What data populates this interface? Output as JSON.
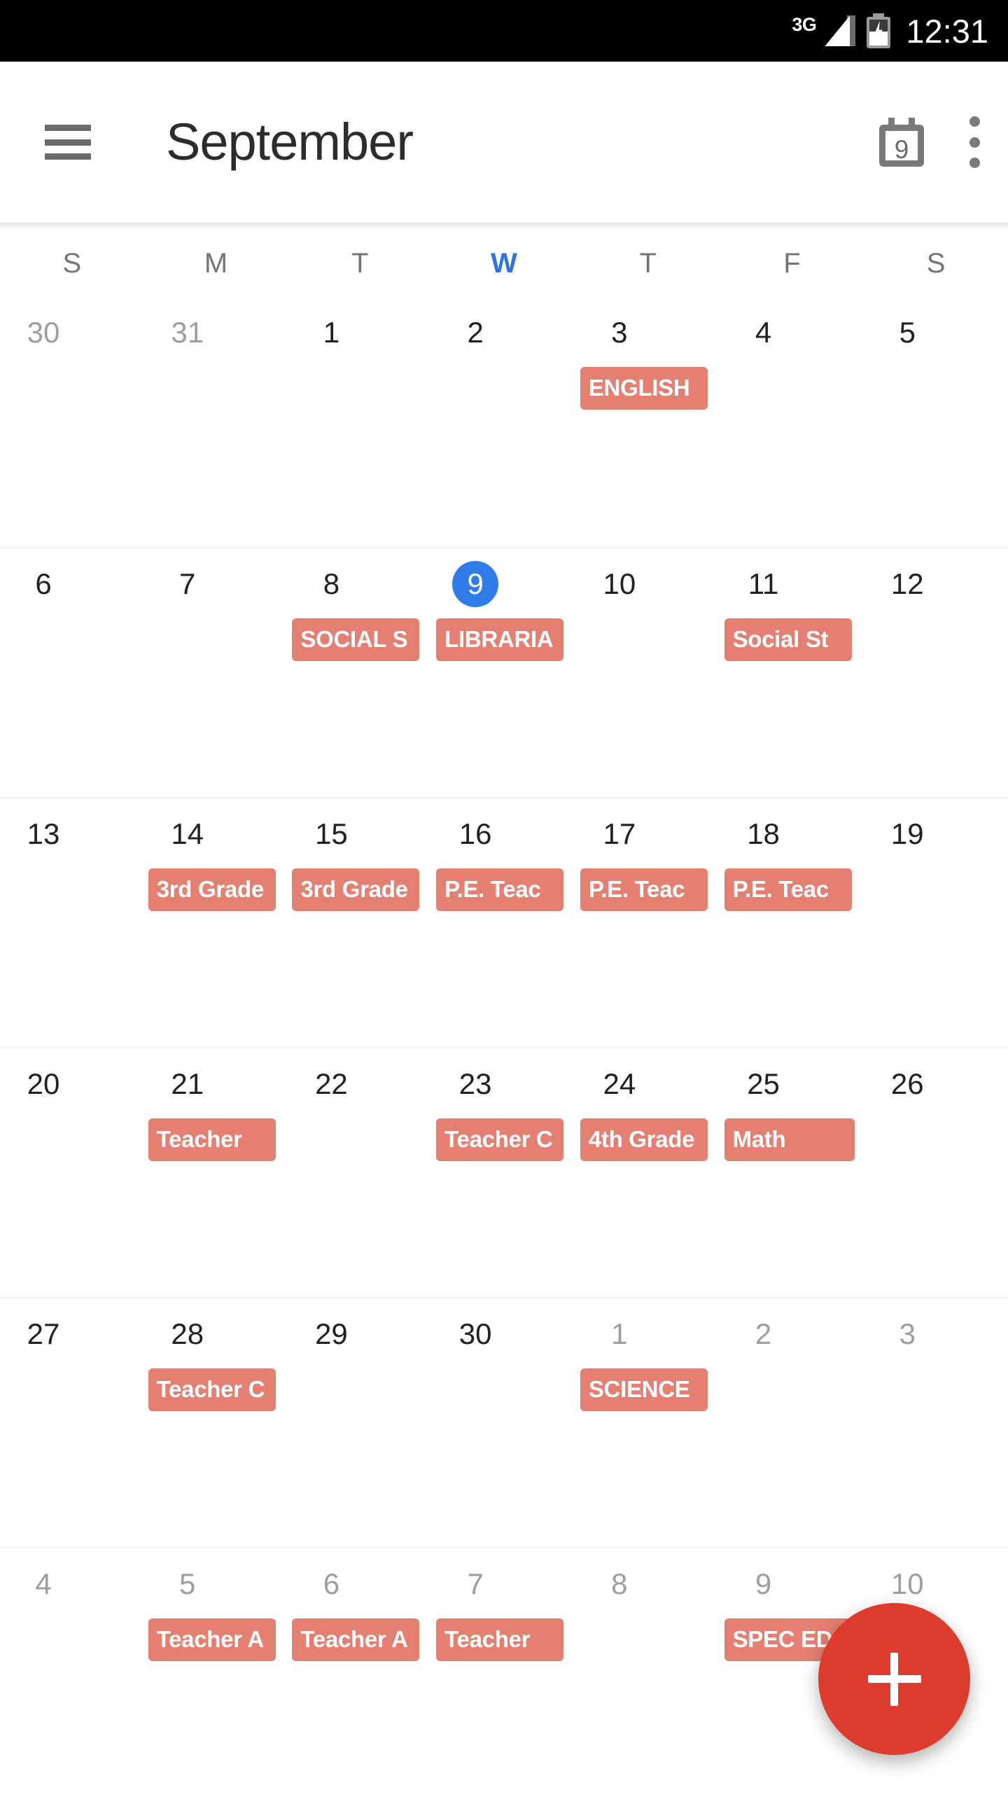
{
  "status_bar": {
    "network_type": "3G",
    "signal_icon": "signal-bars-icon",
    "battery_icon": "battery-charging-icon",
    "time": "12:31"
  },
  "app_bar": {
    "menu_icon": "hamburger-menu-icon",
    "title": "September",
    "today_icon": "calendar-today-icon",
    "today_icon_day": "9",
    "overflow_icon": "overflow-menu-icon"
  },
  "calendar": {
    "weekday_headers": [
      {
        "label": "S",
        "is_today": false
      },
      {
        "label": "M",
        "is_today": false
      },
      {
        "label": "T",
        "is_today": false
      },
      {
        "label": "W",
        "is_today": true
      },
      {
        "label": "T",
        "is_today": false
      },
      {
        "label": "F",
        "is_today": false
      },
      {
        "label": "S",
        "is_today": false
      }
    ],
    "accent_today_color": "#2f7ce8",
    "event_chip_color": "#e47f72",
    "fab_color": "#dd3b2d",
    "weeks": [
      [
        {
          "day": "30",
          "muted": true,
          "today": false,
          "events": []
        },
        {
          "day": "31",
          "muted": true,
          "today": false,
          "events": []
        },
        {
          "day": "1",
          "muted": false,
          "today": false,
          "events": []
        },
        {
          "day": "2",
          "muted": false,
          "today": false,
          "events": []
        },
        {
          "day": "3",
          "muted": false,
          "today": false,
          "events": [
            "ENGLISH"
          ]
        },
        {
          "day": "4",
          "muted": false,
          "today": false,
          "events": []
        },
        {
          "day": "5",
          "muted": false,
          "today": false,
          "events": []
        }
      ],
      [
        {
          "day": "6",
          "muted": false,
          "today": false,
          "events": []
        },
        {
          "day": "7",
          "muted": false,
          "today": false,
          "events": []
        },
        {
          "day": "8",
          "muted": false,
          "today": false,
          "events": [
            "SOCIAL S"
          ]
        },
        {
          "day": "9",
          "muted": false,
          "today": true,
          "events": [
            "LIBRARIA"
          ]
        },
        {
          "day": "10",
          "muted": false,
          "today": false,
          "events": []
        },
        {
          "day": "11",
          "muted": false,
          "today": false,
          "events": [
            "Social St"
          ]
        },
        {
          "day": "12",
          "muted": false,
          "today": false,
          "events": []
        }
      ],
      [
        {
          "day": "13",
          "muted": false,
          "today": false,
          "events": []
        },
        {
          "day": "14",
          "muted": false,
          "today": false,
          "events": [
            "3rd Grade"
          ]
        },
        {
          "day": "15",
          "muted": false,
          "today": false,
          "events": [
            "3rd Grade"
          ]
        },
        {
          "day": "16",
          "muted": false,
          "today": false,
          "events": [
            "P.E. Teac"
          ]
        },
        {
          "day": "17",
          "muted": false,
          "today": false,
          "events": [
            "P.E. Teac"
          ]
        },
        {
          "day": "18",
          "muted": false,
          "today": false,
          "events": [
            "P.E. Teac"
          ]
        },
        {
          "day": "19",
          "muted": false,
          "today": false,
          "events": []
        }
      ],
      [
        {
          "day": "20",
          "muted": false,
          "today": false,
          "events": []
        },
        {
          "day": "21",
          "muted": false,
          "today": false,
          "events": [
            "Teacher"
          ]
        },
        {
          "day": "22",
          "muted": false,
          "today": false,
          "events": []
        },
        {
          "day": "23",
          "muted": false,
          "today": false,
          "events": [
            "Teacher C"
          ]
        },
        {
          "day": "24",
          "muted": false,
          "today": false,
          "events": [
            "4th Grade"
          ]
        },
        {
          "day": "25",
          "muted": false,
          "today": false,
          "events": [
            "Math"
          ]
        },
        {
          "day": "26",
          "muted": false,
          "today": false,
          "events": []
        }
      ],
      [
        {
          "day": "27",
          "muted": false,
          "today": false,
          "events": []
        },
        {
          "day": "28",
          "muted": false,
          "today": false,
          "events": [
            "Teacher C"
          ]
        },
        {
          "day": "29",
          "muted": false,
          "today": false,
          "events": []
        },
        {
          "day": "30",
          "muted": false,
          "today": false,
          "events": []
        },
        {
          "day": "1",
          "muted": true,
          "today": false,
          "events": [
            "SCIENCE"
          ]
        },
        {
          "day": "2",
          "muted": true,
          "today": false,
          "events": []
        },
        {
          "day": "3",
          "muted": true,
          "today": false,
          "events": []
        }
      ],
      [
        {
          "day": "4",
          "muted": true,
          "today": false,
          "events": []
        },
        {
          "day": "5",
          "muted": true,
          "today": false,
          "events": [
            "Teacher A"
          ]
        },
        {
          "day": "6",
          "muted": true,
          "today": false,
          "events": [
            "Teacher A"
          ]
        },
        {
          "day": "7",
          "muted": true,
          "today": false,
          "events": [
            "Teacher"
          ]
        },
        {
          "day": "8",
          "muted": true,
          "today": false,
          "events": []
        },
        {
          "day": "9",
          "muted": true,
          "today": false,
          "events": [
            "SPEC ED"
          ]
        },
        {
          "day": "10",
          "muted": true,
          "today": false,
          "events": []
        }
      ]
    ]
  },
  "fab": {
    "icon": "plus-icon",
    "label": "Add event"
  }
}
